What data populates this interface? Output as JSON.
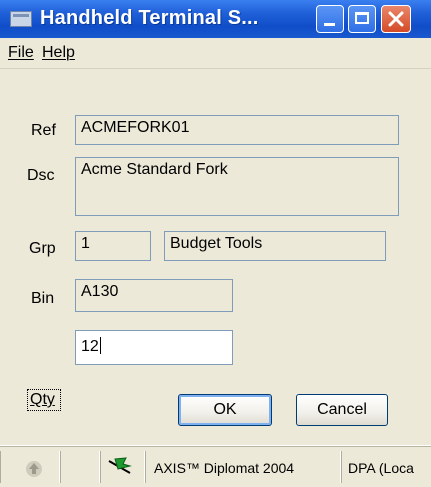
{
  "window": {
    "title": "Handheld Terminal S..."
  },
  "menu": {
    "file": "File",
    "help": "Help"
  },
  "form": {
    "ref": {
      "label": "Ref",
      "value": "ACMEFORK01"
    },
    "dsc": {
      "label": "Dsc",
      "value": "Acme Standard Fork"
    },
    "grp": {
      "label": "Grp",
      "code": "1",
      "name": "Budget Tools"
    },
    "bin": {
      "label": "Bin",
      "value": "A130"
    },
    "qty": {
      "label": "Qty",
      "value": "12"
    }
  },
  "buttons": {
    "ok": "OK",
    "cancel": "Cancel"
  },
  "status": {
    "product": "AXIS™ Diplomat 2004",
    "server": "DPA (Loca"
  },
  "colors": {
    "titlebar": "#1f5fd8",
    "close_button": "#d44b26",
    "window_bg": "#ece9d8",
    "field_border": "#7f9db9",
    "flag_green": "#1f9a2e"
  },
  "icons": {
    "app": "app-window-icon",
    "minimize": "minimize-icon",
    "maximize": "maximize-icon",
    "close": "close-icon",
    "status_arrow": "up-arrow-icon",
    "status_flag": "green-flag-icon"
  }
}
